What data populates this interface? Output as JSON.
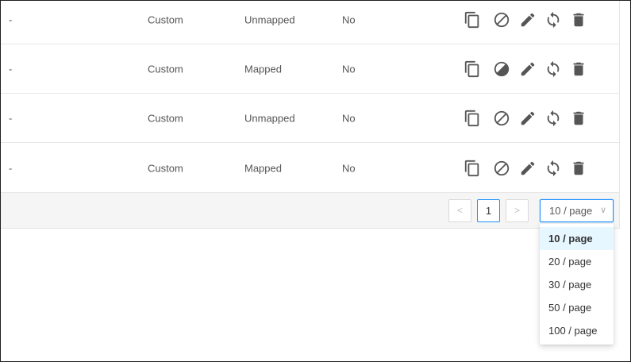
{
  "table": {
    "rows": [
      {
        "name": "-",
        "type": "Custom",
        "mapping": "Unmapped",
        "default": "No"
      },
      {
        "name": "-",
        "type": "Custom",
        "mapping": "Mapped",
        "default": "No"
      },
      {
        "name": "-",
        "type": "Custom",
        "mapping": "Unmapped",
        "default": "No"
      },
      {
        "name": "-",
        "type": "Custom",
        "mapping": "Mapped",
        "default": "No"
      }
    ],
    "actions": [
      "copy-icon",
      "block-icon",
      "edit-icon",
      "sync-icon",
      "delete-icon"
    ],
    "icon_color": "#555555"
  },
  "pagination": {
    "prev": "<",
    "current_page": "1",
    "next": ">",
    "page_size": "10 / page",
    "page_size_chevron": "∨",
    "accent_color": "#1890ff"
  },
  "page_size_dropdown": {
    "options": [
      "10 / page",
      "20 / page",
      "30 / page",
      "50 / page",
      "100 / page"
    ],
    "selected": "10 / page"
  }
}
